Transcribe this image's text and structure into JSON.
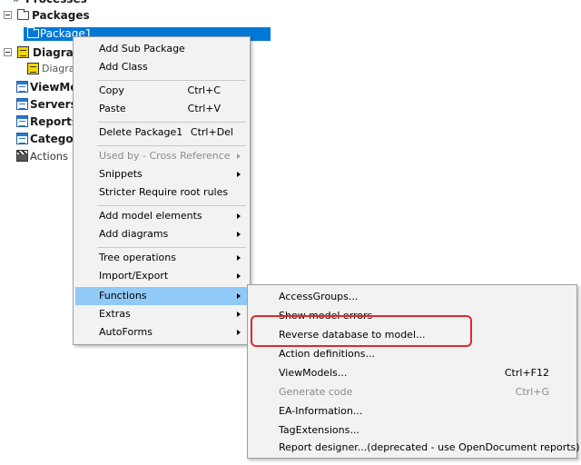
{
  "tree": {
    "processes": "Processes",
    "packages": "Packages",
    "package1": "Package1",
    "diagrams": "Diagrams",
    "diagram_child": "Diagram",
    "viewmodels": "ViewModels",
    "servers": "Servers",
    "reports": "Reports",
    "categories": "Categories",
    "actions": "Actions"
  },
  "context_menu": {
    "add_sub_package": "Add Sub Package",
    "add_class": "Add Class",
    "copy": "Copy",
    "copy_shortcut": "Ctrl+C",
    "paste": "Paste",
    "paste_shortcut": "Ctrl+V",
    "delete": "Delete Package1",
    "delete_shortcut": "Ctrl+Del",
    "used_by": "Used by - Cross Reference",
    "snippets": "Snippets",
    "stricter": "Stricter Require root rules",
    "add_model_elements": "Add model elements",
    "add_diagrams": "Add diagrams",
    "tree_operations": "Tree operations",
    "import_export": "Import/Export",
    "functions": "Functions",
    "extras": "Extras",
    "autoforms": "AutoForms"
  },
  "functions_menu": {
    "access_groups": "AccessGroups...",
    "show_model_errors": "Show model errors",
    "reverse_database": "Reverse database to model...",
    "action_definitions": "Action definitions...",
    "viewmodels": "ViewModels...",
    "viewmodels_shortcut": "Ctrl+F12",
    "generate_code": "Generate code",
    "generate_code_shortcut": "Ctrl+G",
    "ea_information": "EA-Information...",
    "tag_extensions": "TagExtensions...",
    "report_designer": "Report designer...(deprecated - use OpenDocument reports)"
  },
  "colors": {
    "selection": "#0078d7",
    "menu_active": "#91c9f7",
    "highlight_box": "#e4262b"
  }
}
